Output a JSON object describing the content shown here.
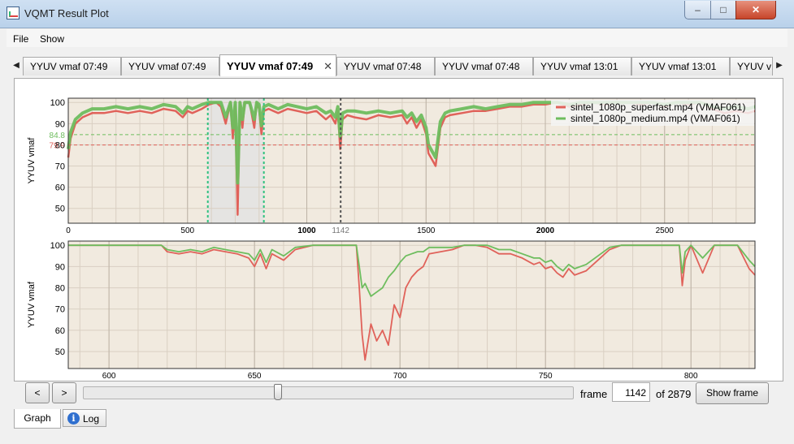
{
  "window": {
    "title": "VQMT Result Plot",
    "minimize_label": "–",
    "maximize_label": "□",
    "close_label": "✕"
  },
  "menu": {
    "file": "File",
    "show": "Show"
  },
  "tabs": [
    {
      "label": "YYUV vmaf 07:49"
    },
    {
      "label": "YYUV vmaf 07:49"
    },
    {
      "label": "YYUV vmaf 07:49",
      "active": true
    },
    {
      "label": "YYUV vmaf 07:48"
    },
    {
      "label": "YYUV vmaf 07:48"
    },
    {
      "label": "YYUV vmaf 13:01"
    },
    {
      "label": "YYUV vmaf 13:01"
    },
    {
      "label": "YYUV v"
    }
  ],
  "tab_close_label": "✕",
  "tab_scroll_left": "◀",
  "tab_scroll_right": "▶",
  "colors": {
    "series1": "#e0625a",
    "series2": "#6ebd5e",
    "plot_bg": "#f1eadf",
    "selection": "#e2e2e2"
  },
  "chart_data": [
    {
      "type": "line",
      "ylabel": "YYUV vmaf",
      "xlim": [
        0,
        2879
      ],
      "ylim": [
        43,
        102
      ],
      "x_ticks": [
        0,
        500,
        1000,
        1500,
        2000,
        2500
      ],
      "y_ticks": [
        50,
        60,
        70,
        80,
        90,
        100
      ],
      "current_frame": 1142,
      "current_frame_label": "1142",
      "selection_range": [
        585,
        820
      ],
      "averages": [
        {
          "series": "sintel_1080p_superfast.mp4 (VMAF061)",
          "value": 79.9,
          "label": "79.9"
        },
        {
          "series": "sintel_1080p_medium.mp4 (VMAF061)",
          "value": 84.8,
          "label": "84.8"
        }
      ],
      "legend_position": "top-right",
      "legend": [
        "sintel_1080p_superfast.mp4 (VMAF061)",
        "sintel_1080p_medium.mp4 (VMAF061)"
      ],
      "series": [
        {
          "name": "sintel_1080p_superfast.mp4 (VMAF061)",
          "color": "#e0625a",
          "x": [
            0,
            10,
            30,
            60,
            100,
            150,
            200,
            250,
            300,
            350,
            400,
            450,
            480,
            500,
            520,
            560,
            590,
            620,
            640,
            660,
            680,
            690,
            700,
            710,
            720,
            730,
            740,
            760,
            780,
            790,
            800,
            810,
            820,
            840,
            880,
            920,
            960,
            1000,
            1040,
            1080,
            1100,
            1120,
            1130,
            1140,
            1142,
            1150,
            1170,
            1200,
            1250,
            1300,
            1350,
            1400,
            1420,
            1440,
            1460,
            1480,
            1500,
            1510,
            1530,
            1540,
            1560,
            1580,
            1600,
            1650,
            1700,
            1750,
            1800,
            1850,
            1900,
            1950,
            2000,
            2050,
            2100,
            2150,
            2200,
            2250,
            2300,
            2350,
            2400,
            2450,
            2500,
            2550,
            2600,
            2650,
            2700,
            2750,
            2800,
            2850,
            2879
          ],
          "values": [
            74,
            83,
            90,
            93,
            95,
            95,
            96,
            95,
            96,
            95,
            97,
            96,
            93,
            96,
            95,
            97,
            99,
            100,
            98,
            90,
            100,
            83,
            99,
            47,
            100,
            88,
            100,
            100,
            88,
            100,
            97,
            85,
            96,
            97,
            95,
            97,
            96,
            95,
            96,
            92,
            94,
            90,
            96,
            78,
            80,
            92,
            94,
            93,
            92,
            94,
            93,
            94,
            90,
            93,
            88,
            92,
            85,
            76,
            72,
            70,
            88,
            93,
            94,
            95,
            96,
            96,
            97,
            98,
            98,
            99,
            99,
            100,
            98,
            99,
            100,
            99,
            100,
            100,
            99,
            100,
            98,
            100,
            99,
            100,
            97,
            95,
            96,
            95,
            96
          ]
        },
        {
          "name": "sintel_1080p_medium.mp4 (VMAF061)",
          "color": "#6ebd5e",
          "x": [
            0,
            10,
            30,
            60,
            100,
            150,
            200,
            250,
            300,
            350,
            400,
            450,
            480,
            500,
            520,
            560,
            590,
            620,
            640,
            660,
            680,
            690,
            700,
            710,
            720,
            730,
            740,
            760,
            780,
            790,
            800,
            810,
            820,
            840,
            880,
            920,
            960,
            1000,
            1040,
            1080,
            1100,
            1120,
            1130,
            1140,
            1142,
            1150,
            1170,
            1200,
            1250,
            1300,
            1350,
            1400,
            1420,
            1440,
            1460,
            1480,
            1500,
            1510,
            1530,
            1540,
            1560,
            1580,
            1600,
            1650,
            1700,
            1750,
            1800,
            1850,
            1900,
            1950,
            2000,
            2050,
            2100,
            2150,
            2200,
            2250,
            2300,
            2350,
            2400,
            2450,
            2500,
            2550,
            2600,
            2650,
            2700,
            2750,
            2800,
            2850,
            2879
          ],
          "values": [
            78,
            86,
            92,
            95,
            97,
            97,
            98,
            97,
            98,
            97,
            99,
            98,
            95,
            98,
            97,
            99,
            100,
            100,
            100,
            93,
            100,
            88,
            100,
            62,
            100,
            92,
            100,
            100,
            92,
            100,
            99,
            89,
            98,
            99,
            97,
            99,
            98,
            97,
            98,
            95,
            96,
            93,
            98,
            84,
            85,
            95,
            96,
            96,
            95,
            96,
            95,
            96,
            93,
            95,
            91,
            94,
            88,
            80,
            76,
            74,
            91,
            95,
            96,
            97,
            98,
            97,
            98,
            99,
            99,
            100,
            100,
            100,
            99,
            100,
            100,
            100,
            100,
            100,
            100,
            100,
            99,
            100,
            100,
            100,
            98,
            97,
            98,
            97,
            98
          ]
        }
      ]
    },
    {
      "type": "line",
      "ylabel": "YYUV vmaf",
      "xlim": [
        586,
        822
      ],
      "ylim": [
        42,
        102
      ],
      "x_ticks": [
        600,
        650,
        700,
        750,
        800
      ],
      "y_ticks": [
        50,
        60,
        70,
        80,
        90,
        100
      ],
      "series": [
        {
          "name": "sintel_1080p_superfast.mp4 (VMAF061)",
          "color": "#e0625a",
          "x": [
            586,
            600,
            610,
            618,
            620,
            624,
            628,
            632,
            636,
            640,
            644,
            648,
            650,
            652,
            654,
            656,
            660,
            664,
            670,
            676,
            680,
            683,
            685,
            686,
            687,
            688,
            690,
            692,
            694,
            696,
            698,
            700,
            702,
            704,
            706,
            708,
            710,
            714,
            718,
            722,
            726,
            730,
            734,
            738,
            742,
            746,
            748,
            750,
            752,
            754,
            756,
            758,
            760,
            764,
            768,
            772,
            776,
            780,
            784,
            786,
            790,
            794,
            796,
            797,
            798,
            800,
            804,
            808,
            812,
            816,
            820,
            822
          ],
          "values": [
            100,
            100,
            100,
            100,
            97,
            96,
            97,
            96,
            98,
            97,
            96,
            94,
            90,
            96,
            89,
            96,
            93,
            98,
            100,
            100,
            100,
            100,
            100,
            80,
            58,
            46,
            63,
            55,
            60,
            53,
            72,
            66,
            80,
            85,
            88,
            90,
            96,
            97,
            98,
            100,
            100,
            99,
            96,
            96,
            94,
            91,
            92,
            89,
            90,
            87,
            85,
            89,
            86,
            88,
            93,
            98,
            100,
            100,
            100,
            100,
            100,
            100,
            100,
            81,
            93,
            100,
            87,
            100,
            100,
            100,
            89,
            86
          ]
        },
        {
          "name": "sintel_1080p_medium.mp4 (VMAF061)",
          "color": "#6ebd5e",
          "x": [
            586,
            600,
            610,
            618,
            620,
            624,
            628,
            632,
            636,
            640,
            644,
            648,
            650,
            652,
            654,
            656,
            660,
            664,
            670,
            676,
            680,
            683,
            685,
            686,
            687,
            688,
            690,
            692,
            694,
            696,
            698,
            700,
            702,
            704,
            706,
            708,
            710,
            714,
            718,
            722,
            726,
            730,
            734,
            738,
            742,
            746,
            748,
            750,
            752,
            754,
            756,
            758,
            760,
            764,
            768,
            772,
            776,
            780,
            784,
            786,
            790,
            794,
            796,
            797,
            798,
            800,
            804,
            808,
            812,
            816,
            820,
            822
          ],
          "values": [
            100,
            100,
            100,
            100,
            98,
            97,
            98,
            97,
            99,
            98,
            97,
            96,
            93,
            98,
            92,
            98,
            95,
            99,
            100,
            100,
            100,
            100,
            100,
            90,
            80,
            82,
            76,
            78,
            80,
            85,
            88,
            92,
            95,
            96,
            97,
            97,
            99,
            99,
            99,
            100,
            100,
            100,
            98,
            98,
            96,
            94,
            94,
            92,
            93,
            90,
            88,
            91,
            89,
            91,
            95,
            99,
            100,
            100,
            100,
            100,
            100,
            100,
            100,
            87,
            97,
            100,
            94,
            100,
            100,
            100,
            93,
            90
          ]
        }
      ]
    }
  ],
  "bottom": {
    "prev_label": "<",
    "next_label": ">",
    "slider_value": 1142,
    "slider_max": 2879,
    "frame_label": "frame",
    "frame_value": "1142",
    "of_label": "of 2879",
    "show_frame_label": "Show frame"
  },
  "bottom_tabs": {
    "graph": "Graph",
    "log": "Log",
    "info_glyph": "i"
  }
}
